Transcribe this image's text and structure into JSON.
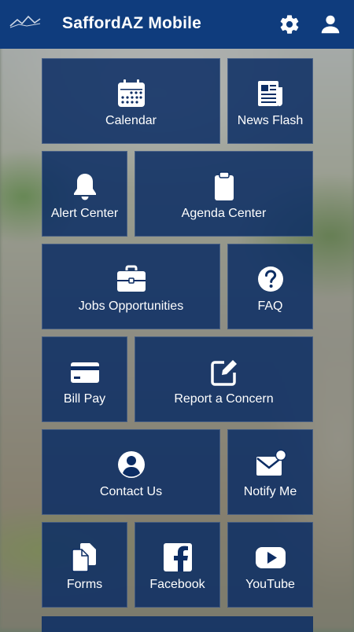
{
  "header": {
    "title": "SaffordAZ Mobile"
  },
  "tiles": [
    {
      "label": "Calendar",
      "icon": "calendar-icon"
    },
    {
      "label": "News Flash",
      "icon": "news-icon"
    },
    {
      "label": "Alert Center",
      "icon": "bell-icon"
    },
    {
      "label": "Agenda Center",
      "icon": "clipboard-icon"
    },
    {
      "label": "Jobs Opportunities",
      "icon": "briefcase-icon"
    },
    {
      "label": "FAQ",
      "icon": "question-icon"
    },
    {
      "label": "Bill Pay",
      "icon": "credit-card-icon"
    },
    {
      "label": "Report a Concern",
      "icon": "edit-icon"
    },
    {
      "label": "Contact Us",
      "icon": "account-icon"
    },
    {
      "label": "Notify Me",
      "icon": "mail-notify-icon"
    },
    {
      "label": "Forms",
      "icon": "documents-icon"
    },
    {
      "label": "Facebook",
      "icon": "facebook-icon"
    },
    {
      "label": "YouTube",
      "icon": "youtube-icon"
    }
  ],
  "colors": {
    "appbar": "#0f3c7d",
    "tile": "#0c2d64",
    "text": "#ffffff"
  }
}
